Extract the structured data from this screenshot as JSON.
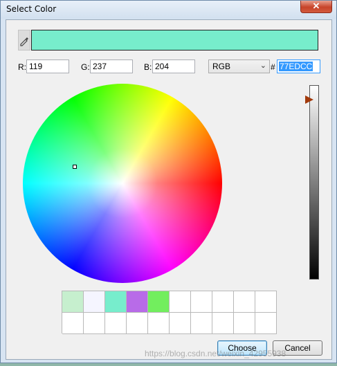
{
  "window": {
    "title": "Select Color",
    "close_glyph": "✕"
  },
  "current_color": "#77EDCC",
  "rgb": {
    "r_label": "R:",
    "r_value": "119",
    "g_label": "G:",
    "g_value": "237",
    "b_label": "B:",
    "b_value": "204"
  },
  "mode": {
    "selected": "RGB"
  },
  "hex": {
    "prefix": "#",
    "value": "77EDCC"
  },
  "value_slider": {
    "level": 1.0,
    "arrow_color": "#a23a0c"
  },
  "swatches": [
    "#c6efce",
    "#f5f5ff",
    "#77edcc",
    "#b86be8",
    "#72ee5e",
    "#ffffff",
    "#ffffff",
    "#ffffff",
    "#ffffff",
    "#ffffff",
    "#ffffff",
    "#ffffff",
    "#ffffff",
    "#ffffff",
    "#ffffff",
    "#ffffff",
    "#ffffff",
    "#ffffff",
    "#ffffff",
    "#ffffff"
  ],
  "buttons": {
    "choose": "Choose",
    "cancel": "Cancel"
  },
  "watermark": "https://blog.csdn.net/weixin_42955938",
  "icons": {
    "eyedropper": "eyedropper-icon",
    "dropdown": "chevron-down-icon"
  }
}
